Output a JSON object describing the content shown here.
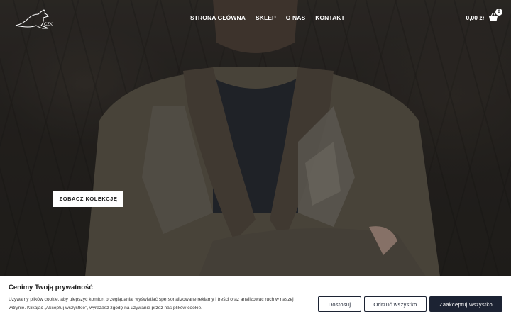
{
  "header": {
    "logo_text": "CZK",
    "nav": [
      {
        "label": "STRONA GŁÓWNA"
      },
      {
        "label": "SKLEP"
      },
      {
        "label": "O NAS"
      },
      {
        "label": "KONTAKT"
      }
    ],
    "cart_total": "0,00 zł",
    "cart_count": "0"
  },
  "hero": {
    "cta_label": "ZOBACZ KOLEKCJĘ"
  },
  "cookie": {
    "title": "Cenimy Twoją prywatność",
    "text": "Używamy plików cookie, aby ulepszyć komfort przeglądania, wyświetlać spersonalizowane reklamy i treści oraz analizować ruch w naszej witrynie. Klikając „Akceptuj wszystkie”, wyrażasz zgodę na używanie przez nas plików cookie.",
    "customize_label": "Dostosuj",
    "reject_label": "Odrzuć wszystko",
    "accept_label": "Zaakceptuj wszystko"
  },
  "colors": {
    "brand_dark": "#1c2333",
    "header_text": "#ffffff"
  }
}
